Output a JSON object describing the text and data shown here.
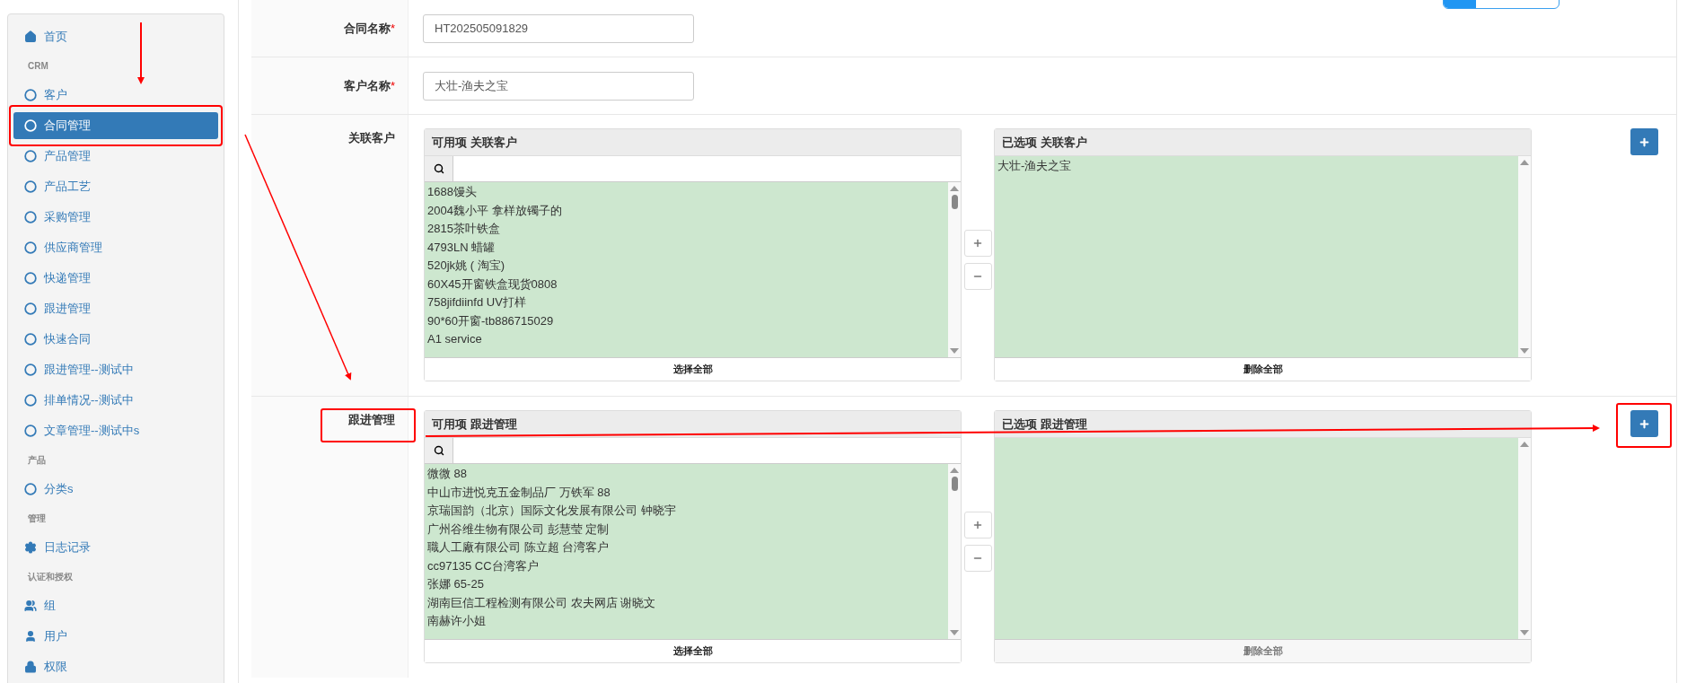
{
  "top_bar": {
    "level": 0.28
  },
  "sidebar": {
    "sections": [
      {
        "items": [
          {
            "label": "首页",
            "kind": "home",
            "selected": false
          }
        ]
      },
      {
        "heading": "CRM",
        "items": [
          {
            "label": "客户",
            "kind": "module",
            "selected": false
          },
          {
            "label": "合同管理",
            "kind": "module",
            "selected": true
          },
          {
            "label": "产品管理",
            "kind": "module",
            "selected": false
          },
          {
            "label": "产品工艺",
            "kind": "module",
            "selected": false
          },
          {
            "label": "采购管理",
            "kind": "module",
            "selected": false
          },
          {
            "label": "供应商管理",
            "kind": "module",
            "selected": false
          },
          {
            "label": "快递管理",
            "kind": "module",
            "selected": false
          },
          {
            "label": "跟进管理",
            "kind": "module",
            "selected": false
          },
          {
            "label": "快速合同",
            "kind": "module",
            "selected": false
          },
          {
            "label": "跟进管理--测试中",
            "kind": "module",
            "selected": false
          },
          {
            "label": "排单情况--测试中",
            "kind": "module",
            "selected": false
          },
          {
            "label": "文章管理--测试中s",
            "kind": "module",
            "selected": false
          }
        ]
      },
      {
        "heading": "产品",
        "items": [
          {
            "label": "分类s",
            "kind": "module",
            "selected": false
          }
        ]
      },
      {
        "heading": "管理",
        "items": [
          {
            "label": "日志记录",
            "kind": "settings",
            "selected": false
          }
        ]
      },
      {
        "heading": "认证和授权",
        "items": [
          {
            "label": "组",
            "kind": "group",
            "selected": false
          },
          {
            "label": "用户",
            "kind": "user",
            "selected": false
          },
          {
            "label": "权限",
            "kind": "lock",
            "selected": false
          }
        ]
      }
    ]
  },
  "form": {
    "rows": [
      {
        "kind": "text",
        "label": "合同名称",
        "required_mark": "*",
        "value": "HT202505091829"
      },
      {
        "kind": "text",
        "label": "客户名称",
        "required_mark": "*",
        "value": "大壮-渔夫之宝"
      },
      {
        "kind": "dual_list",
        "label": "关联客户",
        "available": {
          "title": "可用项 关联客户",
          "items": [
            "1688馒头",
            "2004魏小平 拿样放镯子的",
            "2815茶叶铁盒",
            "4793LN 蜡罐",
            "520jk姚 ( 淘宝)",
            "60X45开窗铁盒现货0808",
            "758jifdiinfd UV打样",
            "90*60开窗-tb886715029",
            "A1 service"
          ],
          "action": {
            "label": "选择全部",
            "disabled": false
          }
        },
        "chosen": {
          "title": "已选项 关联客户",
          "items": [
            "大壮-渔夫之宝"
          ],
          "action": {
            "label": "删除全部",
            "disabled": false
          }
        }
      },
      {
        "kind": "dual_list",
        "label": "跟进管理",
        "available": {
          "title": "可用项 跟进管理",
          "items": [
            "微微 88",
            "中山市进悦克五金制品厂 万铁军 88",
            "京瑞国韵（北京）国际文化发展有限公司 钟晓宇",
            "广州谷维生物有限公司 彭慧莹 定制",
            "職人工廠有限公司 陈立超 台湾客户",
            "cc97135 CC台湾客户",
            "张娜 65-25",
            "湖南巨信工程检测有限公司 农夫网店 谢晓文",
            "南赫许小姐"
          ],
          "action": {
            "label": "选择全部",
            "disabled": false
          }
        },
        "chosen": {
          "title": "已选项 跟进管理",
          "action": {
            "label": "删除全部",
            "disabled": true
          }
        }
      }
    ]
  }
}
